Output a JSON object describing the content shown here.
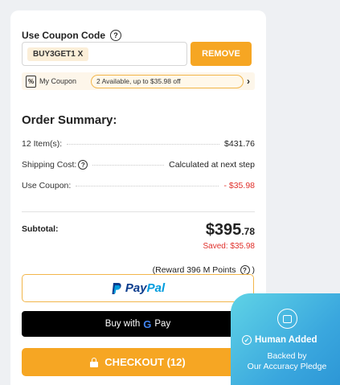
{
  "coupon": {
    "title": "Use Coupon Code",
    "help": "?",
    "applied_code": "BUY3GET1 X",
    "remove_label": "REMOVE",
    "my_coupon_label": "My Coupon",
    "available_text": "2 Available, up to $35.98 off",
    "chevron": "›"
  },
  "summary": {
    "title": "Order Summary:",
    "rows": [
      {
        "label": "12 Item(s):",
        "value": "$431.76"
      },
      {
        "label": "Shipping Cost:",
        "value": "Calculated at next step"
      },
      {
        "label": "Use Coupon:",
        "value": "- $35.98"
      }
    ],
    "subtotal_label": "Subtotal:",
    "subtotal_dollars": "$395",
    "subtotal_cents": ".78",
    "saved": "Saved: $35.98",
    "reward": "(Reward 396 M Points",
    "reward_close": ")"
  },
  "payments": {
    "paypal_a": "Pay",
    "paypal_b": "Pal",
    "gpay_prefix": "Buy with",
    "gpay_g": "G",
    "gpay_pay": "Pay",
    "checkout": "CHECKOUT (12)"
  },
  "badge": {
    "title": "Human Added",
    "line1": "Backed by",
    "line2": "Our Accuracy Pledge"
  },
  "colors": {
    "accent": "#f6a623",
    "negative": "#e0302b",
    "paypal_dark": "#0a3b8c",
    "paypal_light": "#009cde",
    "badge": "#3aa7de"
  }
}
